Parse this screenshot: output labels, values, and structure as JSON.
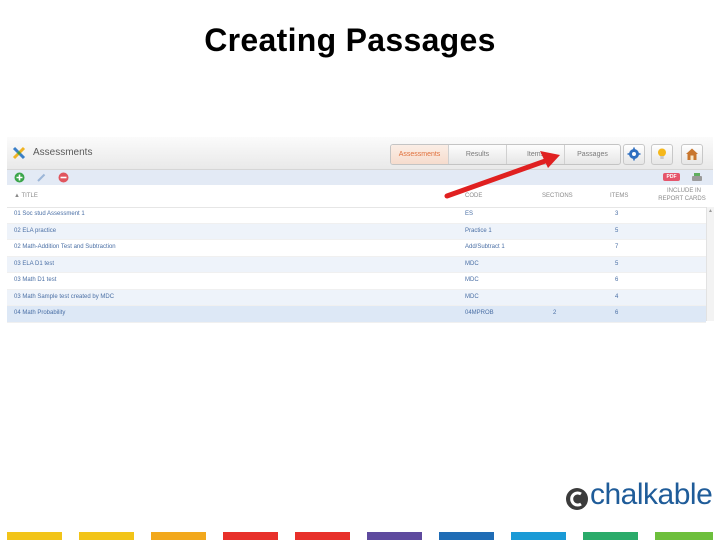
{
  "slide": {
    "title": "Creating Passages"
  },
  "app": {
    "title": "Assessments",
    "tabs": [
      {
        "label": "Assessments",
        "active": true
      },
      {
        "label": "Results",
        "active": false
      },
      {
        "label": "Items",
        "active": false
      },
      {
        "label": "Passages",
        "active": false
      }
    ],
    "header_buttons": [
      "settings-icon",
      "lightbulb-icon",
      "home-icon"
    ],
    "toolbar": {
      "icons": [
        "add-icon",
        "edit-icon",
        "delete-icon"
      ],
      "pdf_label": "PDF",
      "print_icon": "print-icon"
    },
    "columns": {
      "title": "▲ TITLE",
      "code": "CODE",
      "sections": "SECTIONS",
      "items": "ITEMS",
      "report_cards_1": "INCLUDE IN",
      "report_cards_2": "REPORT CARDS"
    },
    "rows": [
      {
        "title": "01 Soc stud Assessment 1",
        "code": "ES",
        "sections": "",
        "items": "3"
      },
      {
        "title": "02 ELA practice",
        "code": "Practice 1",
        "sections": "",
        "items": "5"
      },
      {
        "title": "02 Math-Addition Test and Subtraction",
        "code": "Add/Subtract 1",
        "sections": "",
        "items": "7"
      },
      {
        "title": "03 ELA D1 test",
        "code": "MDC",
        "sections": "",
        "items": "5"
      },
      {
        "title": "03 Math D1 test",
        "code": "MDC",
        "sections": "",
        "items": "6"
      },
      {
        "title": "03 Math Sample test created by MDC",
        "code": "MDC",
        "sections": "",
        "items": "4"
      },
      {
        "title": "04 Math Probability",
        "code": "04MPROB",
        "sections": "2",
        "items": "6"
      }
    ],
    "colors": {
      "accent": "#e0703c",
      "link": "#4a6fa5",
      "toolbar": "#e3eaf5"
    }
  },
  "annotation": {
    "arrow_color": "#e02020"
  },
  "brand": {
    "name": "chalkable",
    "color": "#1f5c99"
  },
  "footer_colors": [
    "#f2c418",
    "#f2c418",
    "#f2a81c",
    "#e8302a",
    "#e8302a",
    "#5e4a9e",
    "#1f6cb5",
    "#1a9ad6",
    "#2aab6a",
    "#6dbf3c"
  ]
}
